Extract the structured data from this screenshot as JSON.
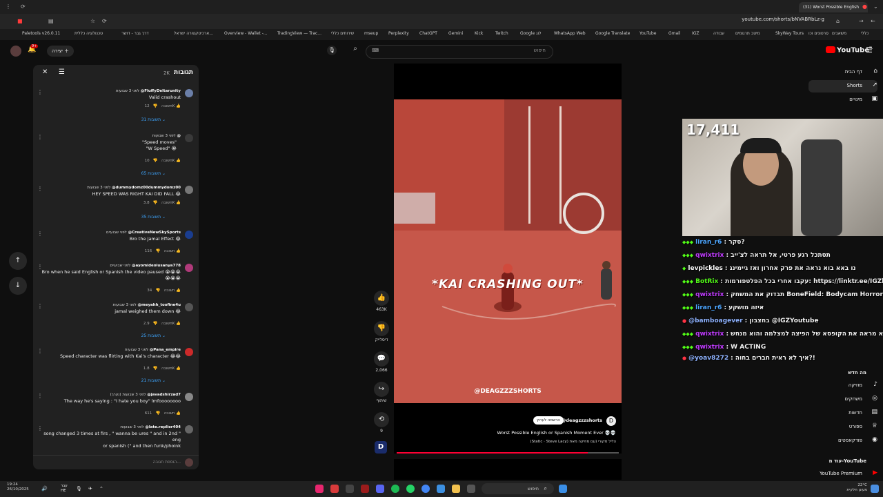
{
  "browser": {
    "tab_title": "(31) Worst Possible English",
    "url": "youtube.com/shorts/bNVABRbLz-g",
    "bookmarks": [
      "Paletools v26.0.11",
      "טכנולוגיה כללית",
      "דרך גבר - דושר",
      "ארכיטקטורה ישראל...",
      "Overview - Wallet -...",
      "TradingView — Trac...",
      "שירותים כללי",
      "mseup",
      "Perplexity",
      "ChatGPT",
      "Gemini",
      "Kick",
      "Twitch",
      "Google לוג",
      "WhatsApp Web",
      "Google Translate",
      "YouTube",
      "Gmail",
      "IGZ",
      "עבודה",
      "מיטב תרגומים",
      "SkyWay Tours",
      "סרטונים וכו",
      "משאבים",
      "כללי"
    ]
  },
  "yt_header": {
    "create_label": "יצירה",
    "search_placeholder": "חיפוש",
    "notif_count": "9+",
    "logo_text": "YouTube",
    "logo_region": "IL"
  },
  "comments": {
    "title": "תגובות",
    "count": "2K",
    "reply_label": "תשובה",
    "footer_placeholder": "הוספת תגובה...",
    "items": [
      {
        "user": "@FluffyDeltarunity",
        "time": "לפני 3 שבועות",
        "text": "Valid crashout",
        "likes": "12K",
        "replies": "31 תשובות",
        "color": "#6b7fa8"
      },
      {
        "user": "@",
        "time": "לפני 3 שבועות",
        "text": "\"Speed moves\"\n\"W Speed\" 😭",
        "likes": "10K",
        "replies": "65 תשובות",
        "color": "#3a3a3a"
      },
      {
        "user": "@dummydomz00dummydomz00",
        "time": "לפני 3 שבועות",
        "text": "HEY SPEED WAS RIGHT KAI DID FALL 😂",
        "likes": "3.8K",
        "replies": "35 תשובות",
        "color": "#777"
      },
      {
        "user": "@CreativeNewSkySports",
        "time": "לפני שבועיים",
        "text": "Bro the Jamal Effect 😂",
        "likes": "116",
        "replies": "",
        "color": "#1a3d8f"
      },
      {
        "user": "@ayomideolusanya778",
        "time": "לפני שבועיים",
        "text": "Bro when he said English or Spanish the video paused 😭😭😭\n😭😭😭",
        "likes": "34",
        "replies": "",
        "color": "#b03a7a"
      },
      {
        "user": "@meyahh_toofine4u",
        "time": "לפני 3 שבועות",
        "text": "jamal weighed them down 😂",
        "likes": "2.9K",
        "replies": "25 תשובות",
        "color": "#555"
      },
      {
        "user": "@Pana_empire",
        "time": "לפני 3 שבועות",
        "text": "Speed character was flirting with Kai's character 😂😂",
        "likes": "1.8K",
        "replies": "21 תשובות",
        "color": "#cc2a2a"
      },
      {
        "user": "@javadshirzad7",
        "time": "לפני 3 שבועות (נערך)",
        "text": "The way he's saying : \"I hate you boy\" lmfoooooooo",
        "likes": "611",
        "replies": "",
        "color": "#888"
      },
      {
        "user": "@late.replier404",
        "time": "לפני 3 שבועות",
        "text": "song changed 3 times at firs , \" wanna be ures \" and in 2nd \" eng\nor spanish (\" and then funk/phoink",
        "likes": "",
        "replies": "",
        "color": "#666"
      }
    ]
  },
  "video": {
    "overlay_title": "*KAI CRASHING OUT*",
    "watermark": "@DEAGZZZSHORTS",
    "channel": "@deagzzzshorts",
    "subscribe_label": "הרשמה לערוץ",
    "caption": "Worst Possible English or Spanish Moment Ever 💀💀",
    "music": "(Static · Steve Lacy) צליל מקורי (עם מוזיקה מאת",
    "progress": 0.86
  },
  "actions": {
    "likes": "463K",
    "dislike_label": "דיסלייק",
    "comments": "2,066",
    "share_label": "שיתוף",
    "remix": "9"
  },
  "sidebar": {
    "items": [
      {
        "label": "דף הבית",
        "icon": "⌂"
      },
      {
        "label": "Shorts",
        "icon": "➚"
      },
      {
        "label": "מינויים",
        "icon": "▣"
      }
    ],
    "explore_title": "מה חדש",
    "explore": [
      {
        "label": "מוזיקה",
        "icon": "♪"
      },
      {
        "label": "משחקים",
        "icon": "◎"
      },
      {
        "label": "חדשות",
        "icon": "▤"
      },
      {
        "label": "ספורט",
        "icon": "♕"
      },
      {
        "label": "פודקאסטים",
        "icon": "◉"
      }
    ],
    "more_title": "עוד מ-YouTube",
    "more": [
      {
        "label": "YouTube Premium",
        "icon": "▶"
      }
    ]
  },
  "stream": {
    "viewer_count": "17,411",
    "chat": [
      {
        "name": "liran_r6",
        "text": ": סקר?",
        "color": "#4da6ff"
      },
      {
        "name": "qwixtrix",
        "text": ": תסתכל רגע פרטי, אל תראה לצ'ייב",
        "color": "#c13cff"
      },
      {
        "name": "levpickles",
        "text": ": נו באא בוא נראה את פרק אחרון ואז גיימינג",
        "color": "#ffffff"
      },
      {
        "name": "BotRix",
        "text": ": עקבו אחרי בכל הפלטפורמות: https://linktr.ee/IGZlin",
        "color": "#53fc18"
      },
      {
        "name": "qwixtrix",
        "text": ": תבדוק את המשחק BoneField: Bodycam Horror",
        "color": "#c13cff"
      },
      {
        "name": "liran_r6",
        "text": ": איזה מושקע",
        "color": "#4da6ff"
      },
      {
        "name": "@bamboagever",
        "text": ": בחצבון @IGZYoutube",
        "color": "#8fb3ff"
      },
      {
        "name": "qwixtrix",
        "text": ": הוא מראה את הקופסא של הפיצה למצלמה והוא מנחש",
        "color": "#c13cff"
      },
      {
        "name": "qwixtrix",
        "text": ": W ACTING",
        "color": "#c13cff"
      },
      {
        "name": "@yoav8272",
        "text": ": איך לא ראית חברים בחוה?!",
        "color": "#8fb3ff"
      }
    ]
  },
  "taskbar": {
    "time": "19:24",
    "date": "26/10/2025",
    "lang": "עבר HE",
    "search_label": "חיפוש",
    "weather": "22°C",
    "weather_desc": "מעונן חלקית"
  }
}
